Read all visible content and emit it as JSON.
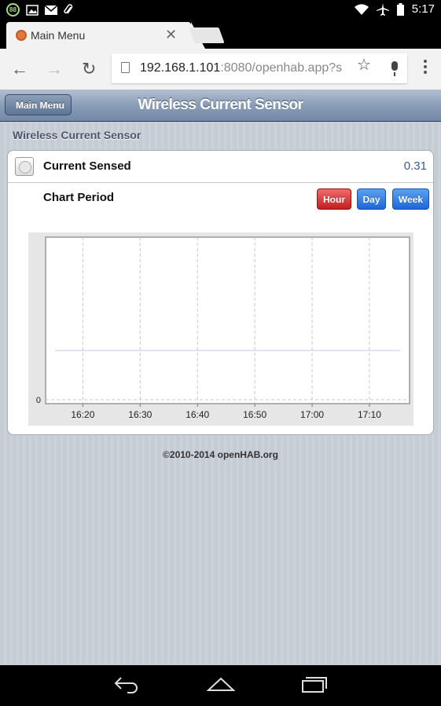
{
  "status_bar": {
    "badge": "88",
    "time": "5:17"
  },
  "browser": {
    "tab_title": "Main Menu",
    "url_host": "192.168.1.101",
    "url_rest": ":8080/openhab.app?s"
  },
  "header": {
    "back_label": "Main Menu",
    "title": "Wireless Current Sensor"
  },
  "section": {
    "title": "Wireless Current Sensor"
  },
  "item": {
    "label": "Current Sensed",
    "value": "0.31"
  },
  "chart_period": {
    "label": "Chart Period",
    "buttons": [
      "Hour",
      "Day",
      "Week"
    ],
    "active": "Hour"
  },
  "chart_data": {
    "type": "line",
    "x_ticks": [
      "16:20",
      "16:30",
      "16:40",
      "16:50",
      "17:00",
      "17:10"
    ],
    "y_ticks": [
      "0"
    ],
    "series": [
      {
        "values": [
          0.31,
          0.31,
          0.31,
          0.31,
          0.31,
          0.31
        ]
      }
    ],
    "grid": true,
    "colors": {
      "line": "#d4dcf4",
      "grid": "#c8c8c8",
      "background": "#e6e6e6"
    }
  },
  "footer": {
    "text": "©2010-2014 openHAB.org"
  }
}
